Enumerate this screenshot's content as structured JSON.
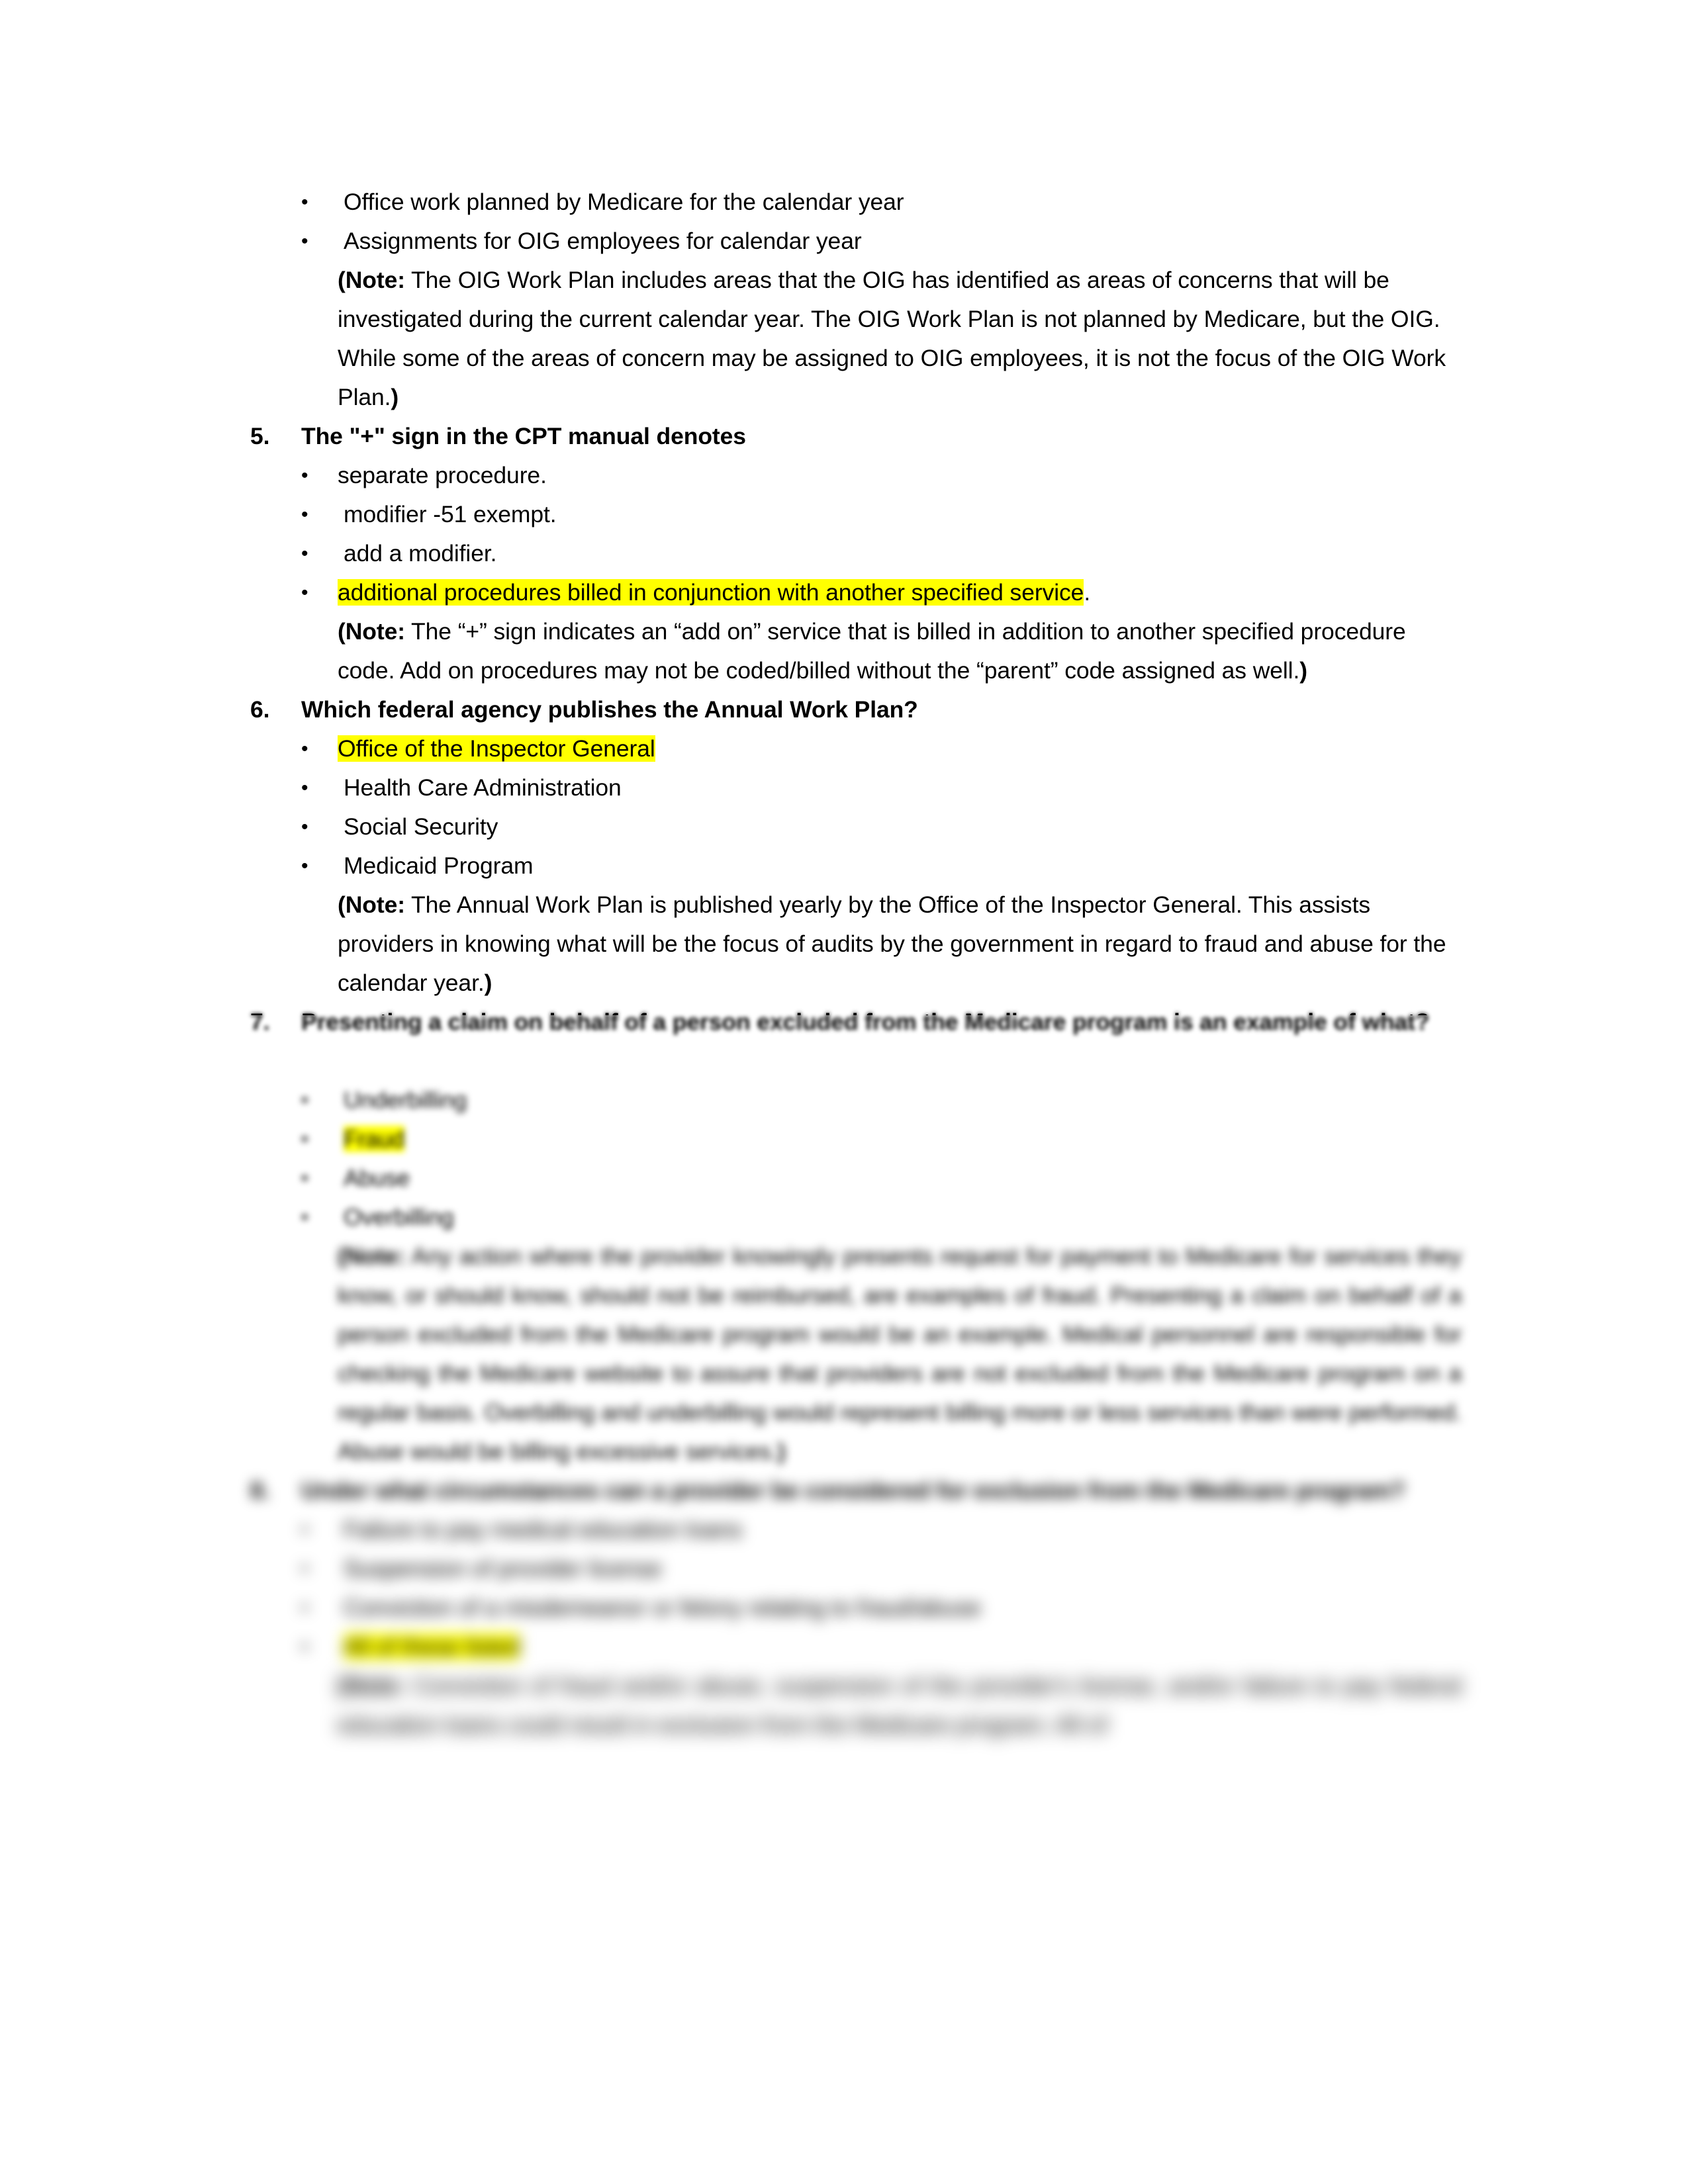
{
  "document": {
    "type": "study-guide-answer-key",
    "page_background": "#ffffff",
    "highlight_color": "#FFFF00",
    "text_color": "#000000"
  },
  "blocks": [
    {
      "kind": "option",
      "bullet": "•",
      "text": "Office work planned by Medicare for the calendar year",
      "highlighted": false,
      "blurred": false
    },
    {
      "kind": "option",
      "bullet": "•",
      "text": "Assignments for OIG employees for calendar year",
      "highlighted": false,
      "blurred": false
    },
    {
      "kind": "note",
      "label": "(Note:",
      "text": " The OIG Work Plan includes areas that the OIG has identified as areas of concerns that will be investigated during the current calendar year. The OIG Work Plan is not planned by Medicare, but the OIG. While some of the areas of concern may be assigned to OIG employees, it is not the focus of the OIG Work Plan.",
      "closing": ")",
      "blurred": false
    },
    {
      "kind": "question",
      "number": "5.",
      "text": "The \"+\" sign in the CPT manual denotes",
      "blurred": false
    },
    {
      "kind": "option",
      "bullet": "•",
      "text": "separate procedure.",
      "highlighted": false,
      "blurred": false
    },
    {
      "kind": "option",
      "bullet": "•",
      "text": "modifier -51 exempt.",
      "highlighted": false,
      "blurred": false
    },
    {
      "kind": "option",
      "bullet": "•",
      "text": "add a modifier.",
      "highlighted": false,
      "blurred": false
    },
    {
      "kind": "option",
      "bullet": "•",
      "text": "additional procedures billed in conjunction with another specified service",
      "trailing": ".",
      "highlighted": true,
      "blurred": false
    },
    {
      "kind": "note",
      "label": "(Note:",
      "text": " The “+” sign indicates an “add on” service that is billed in addition to another specified procedure code. Add on procedures may not be coded/billed without the “parent” code assigned as well.",
      "closing": ")",
      "blurred": false
    },
    {
      "kind": "question",
      "number": "6.",
      "text": "Which federal agency publishes the Annual Work Plan?",
      "blurred": false
    },
    {
      "kind": "option",
      "bullet": "•",
      "text": "Office of the Inspector General",
      "highlighted": true,
      "blurred": false
    },
    {
      "kind": "option",
      "bullet": "•",
      "text": "Health Care Administration",
      "highlighted": false,
      "blurred": false
    },
    {
      "kind": "option",
      "bullet": "•",
      "text": "Social Security",
      "highlighted": false,
      "blurred": false
    },
    {
      "kind": "option",
      "bullet": "•",
      "text": "Medicaid Program",
      "highlighted": false,
      "blurred": false
    },
    {
      "kind": "note",
      "label": "(Note:",
      "text": " The Annual Work Plan is published yearly by the Office of the Inspector General. This assists providers in knowing what will be the focus of audits by the government in regard to fraud and abuse for the calendar year.",
      "closing": ")",
      "blurred": false
    },
    {
      "kind": "question",
      "number": "7.",
      "text": "Presenting a claim on behalf of a person excluded from the Medicare program is an example of what?",
      "blurred": true
    },
    {
      "kind": "option",
      "bullet": "•",
      "text": "Underbilling",
      "highlighted": false,
      "blurred": true
    },
    {
      "kind": "option",
      "bullet": "•",
      "text": "Fraud",
      "highlighted": true,
      "blurred": true
    },
    {
      "kind": "option",
      "bullet": "•",
      "text": "Abuse",
      "highlighted": false,
      "blurred": true
    },
    {
      "kind": "option",
      "bullet": "•",
      "text": "Overbilling",
      "highlighted": false,
      "blurred": true
    },
    {
      "kind": "note",
      "label": "(Note:",
      "text": " Any action where the provider knowingly presents request for payment to Medicare for services they know, or should know, should not be reimbursed, are examples of fraud. Presenting a claim on behalf of a person excluded from the Medicare program would be an example. Medical personnel are responsible for checking the Medicare website to assure that providers are not excluded from the Medicare program on a regular basis.  Overbilling and underbilling would represent billing more or less services than were performed. Abuse would be billing excessive services.",
      "closing": ")",
      "blurred": true
    },
    {
      "kind": "question",
      "number": "8.",
      "text": "Under what circumstances can a provider be considered for exclusion from the Medicare program?",
      "blurred": true
    },
    {
      "kind": "option",
      "bullet": "•",
      "text": "Failure to pay medical education loans",
      "highlighted": false,
      "blurred": true
    },
    {
      "kind": "option",
      "bullet": "•",
      "text": "Suspension of provider license",
      "highlighted": false,
      "blurred": true
    },
    {
      "kind": "option",
      "bullet": "•",
      "text": "Conviction of a misdemeanor or felony relating to fraud/abuse",
      "highlighted": false,
      "blurred": true
    },
    {
      "kind": "option",
      "bullet": "•",
      "text": "All of these listed",
      "highlighted": true,
      "blurred": true
    },
    {
      "kind": "note",
      "label": "(Note:",
      "text": " Conviction of fraud and/or abuse, suspension of the provider's license, and/or failure to pay federal education loans could result in exclusion from the Medicare program.  All of",
      "closing": "",
      "blurred": true
    }
  ]
}
